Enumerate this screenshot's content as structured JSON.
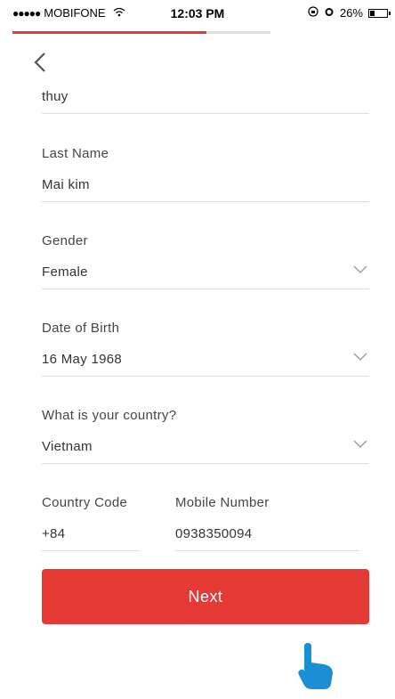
{
  "status_bar": {
    "signal_dots": "●●●●●",
    "carrier": "MOBIFONE",
    "wifi_icon": "wifi-icon",
    "time": "12:03 PM",
    "battery_percent": "26%",
    "battery_level": 0.26
  },
  "progress": {
    "fraction": 0.75,
    "color": "#e53935"
  },
  "back_icon": "‹",
  "form": {
    "first_name": {
      "value": "thuy"
    },
    "last_name": {
      "label": "Last Name",
      "value": "Mai kim"
    },
    "gender": {
      "label": "Gender",
      "value": "Female"
    },
    "dob": {
      "label": "Date of Birth",
      "value": "16 May 1968"
    },
    "country": {
      "label": "What is your country?",
      "value": "Vietnam"
    },
    "country_code": {
      "label": "Country Code",
      "value": "+84"
    },
    "mobile": {
      "label": "Mobile Number",
      "value": "0938350094"
    }
  },
  "chevron": "﹀",
  "next_button": {
    "label": "Next",
    "color": "#e53935"
  },
  "overlay": {
    "icon": "hand-pointer-icon",
    "color": "#1a8fd6"
  }
}
